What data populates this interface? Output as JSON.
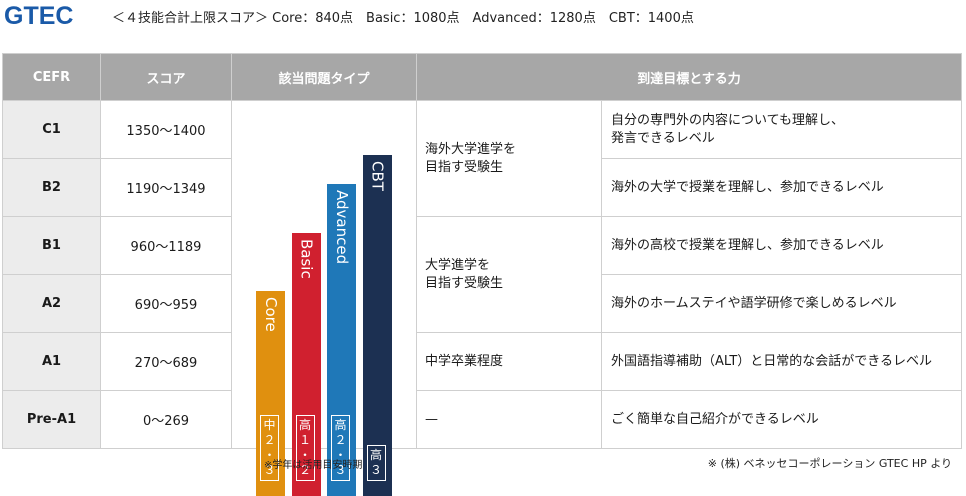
{
  "header": {
    "logo": "GTEC",
    "subtitle": "＜４技能合計上限スコア＞ Core：840点　Basic：1080点　Advanced：1280点　CBT：1400点"
  },
  "table": {
    "headers": [
      "CEFR",
      "スコア",
      "該当問題タイプ",
      "到達目標とする力"
    ],
    "rows": [
      {
        "cefr": "C1",
        "score": "1350〜1400",
        "level": "自分の専門外の内容についても理解し、\n発言できるレベル"
      },
      {
        "cefr": "B2",
        "score": "1190〜1349",
        "level": "海外の大学で授業を理解し、参加できるレベル"
      },
      {
        "cefr": "B1",
        "score": "960〜1189",
        "level": "海外の高校で授業を理解し、参加できるレベル"
      },
      {
        "cefr": "A2",
        "score": "690〜959",
        "level": "海外のホームステイや語学研修で楽しめるレベル"
      },
      {
        "cefr": "A1",
        "score": "270〜689",
        "level": "外国語指導補助（ALT）と日常的な会話ができるレベル"
      },
      {
        "cefr": "Pre-A1",
        "score": "0〜269",
        "level": "ごく簡単な自己紹介ができるレベル"
      }
    ],
    "targets": [
      {
        "text": "海外大学進学を\n目指す受験生"
      },
      {
        "text": "大学進学を\n目指す受験生"
      },
      {
        "text": "中学卒業程度"
      },
      {
        "text": "—"
      }
    ]
  },
  "tests": [
    {
      "name": "Core",
      "grade": "中\n２\n・\n３",
      "color": "#e0900f",
      "max_score": 840
    },
    {
      "name": "Basic",
      "grade": "高\n１\n・\n２",
      "color": "#d0202f",
      "max_score": 1080
    },
    {
      "name": "Advanced",
      "grade": "高\n２\n・\n３",
      "color": "#1f78b8",
      "max_score": 1280
    },
    {
      "name": "CBT",
      "grade": "高\n３",
      "color": "#1c3052",
      "max_score": 1400
    }
  ],
  "footnotes": {
    "left": "※学年は活用目安時期",
    "right": "※ (株) ベネッセコーポレーション GTEC HP より"
  }
}
